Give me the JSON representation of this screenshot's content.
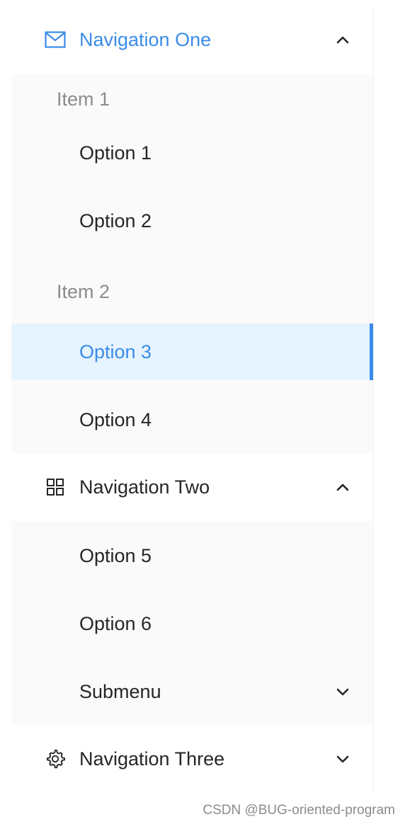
{
  "menu": {
    "nav1": {
      "label": "Navigation One",
      "icon": "mail-icon",
      "expanded": true,
      "groups": [
        {
          "title": "Item 1",
          "options": [
            "Option 1",
            "Option 2"
          ]
        },
        {
          "title": "Item 2",
          "options": [
            "Option 3",
            "Option 4"
          ]
        }
      ]
    },
    "nav2": {
      "label": "Navigation Two",
      "icon": "appstore-icon",
      "expanded": true,
      "options": [
        "Option 5",
        "Option 6"
      ],
      "submenu_label": "Submenu"
    },
    "nav3": {
      "label": "Navigation Three",
      "icon": "setting-icon",
      "expanded": false
    },
    "selected_option": "Option 3"
  },
  "colors": {
    "accent": "#3b8ce8",
    "selected_bg": "#e6f4ff",
    "submenu_bg": "#fafafa",
    "text": "#262626",
    "group_text": "#8c8c8c"
  },
  "watermark": "CSDN @BUG-oriented-program"
}
